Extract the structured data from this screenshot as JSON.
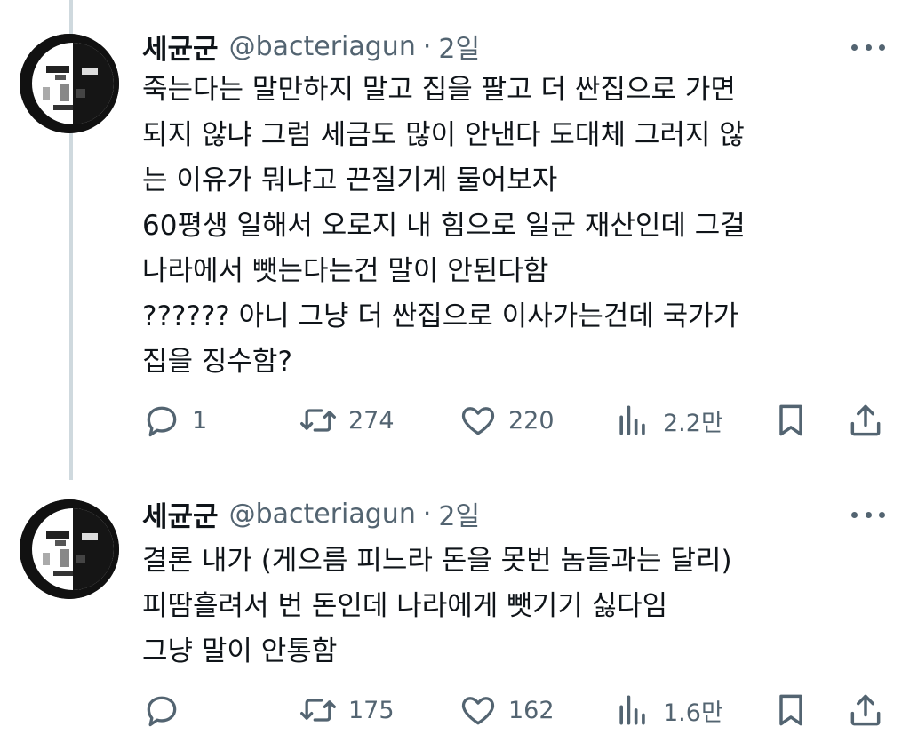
{
  "tweets": [
    {
      "name": "세균군",
      "handle": "@bacteriagun",
      "separator": "·",
      "time": "2일",
      "lines": [
        "죽는다는 말만하지 말고 집을 팔고 더 싼집으로 가면",
        "되지 않냐 그럼 세금도 많이 안낸다 도대체 그러지 않",
        "는 이유가 뭐냐고 끈질기게 물어보자",
        "60평생 일해서 오로지 내 힘으로 일군 재산인데 그걸",
        "나라에서 뺏는다는건 말이 안된다함",
        "?????? 아니 그냥 더 싼집으로 이사가는건데 국가가",
        "집을 징수함?"
      ],
      "replies": "1",
      "retweets": "274",
      "likes": "220",
      "views": "2.2만"
    },
    {
      "name": "세균군",
      "handle": "@bacteriagun",
      "separator": "·",
      "time": "2일",
      "lines": [
        "결론 내가 (게으름 피느라 돈을 못번 놈들과는 달리)",
        "피땀흘려서 번 돈인데 나라에게 뺏기기 싫다임",
        "그냥 말이 안통함"
      ],
      "replies": "",
      "retweets": "175",
      "likes": "162",
      "views": "1.6만"
    }
  ],
  "icons": {
    "reply": "reply-icon",
    "retweet": "retweet-icon",
    "like": "heart-icon",
    "views": "views-icon",
    "bookmark": "bookmark-icon",
    "share": "share-icon",
    "more": "more-icon"
  },
  "colors": {
    "text": "#0f1419",
    "secondary": "#536471",
    "thread_line": "#cfd9de"
  }
}
